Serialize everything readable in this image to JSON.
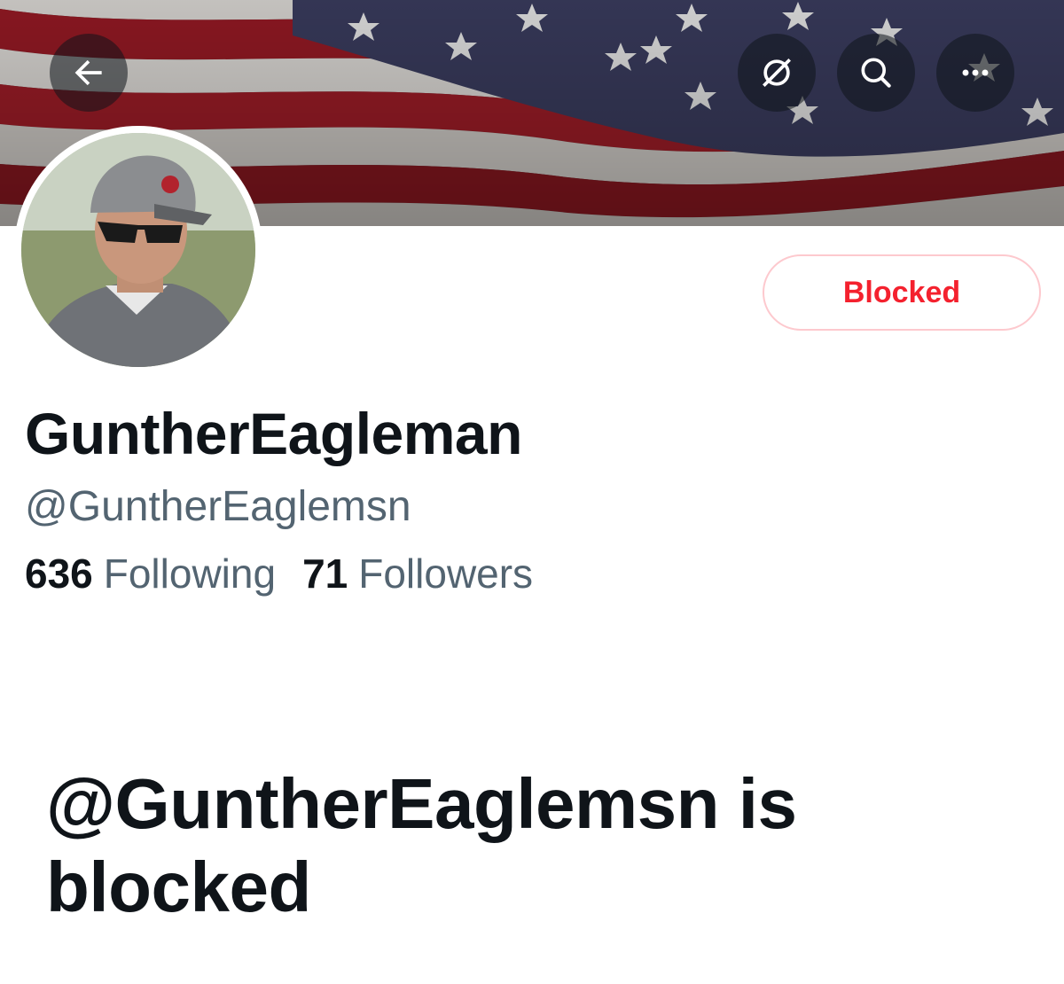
{
  "header": {
    "back_icon": "arrow-left-icon",
    "actions": [
      {
        "name": "translate-icon"
      },
      {
        "name": "search-icon"
      },
      {
        "name": "more-icon"
      }
    ]
  },
  "profile": {
    "display_name": "GuntherEagleman",
    "handle": "@GuntherEaglemsn",
    "following_count": "636",
    "following_label": "Following",
    "followers_count": "71",
    "followers_label": "Followers"
  },
  "blocked_button": {
    "label": "Blocked",
    "color": "#f4212e"
  },
  "blocked_message": "@GuntherEaglemsn is blocked",
  "colors": {
    "text_primary": "#0f1419",
    "text_secondary": "#536471",
    "danger": "#f4212e"
  }
}
